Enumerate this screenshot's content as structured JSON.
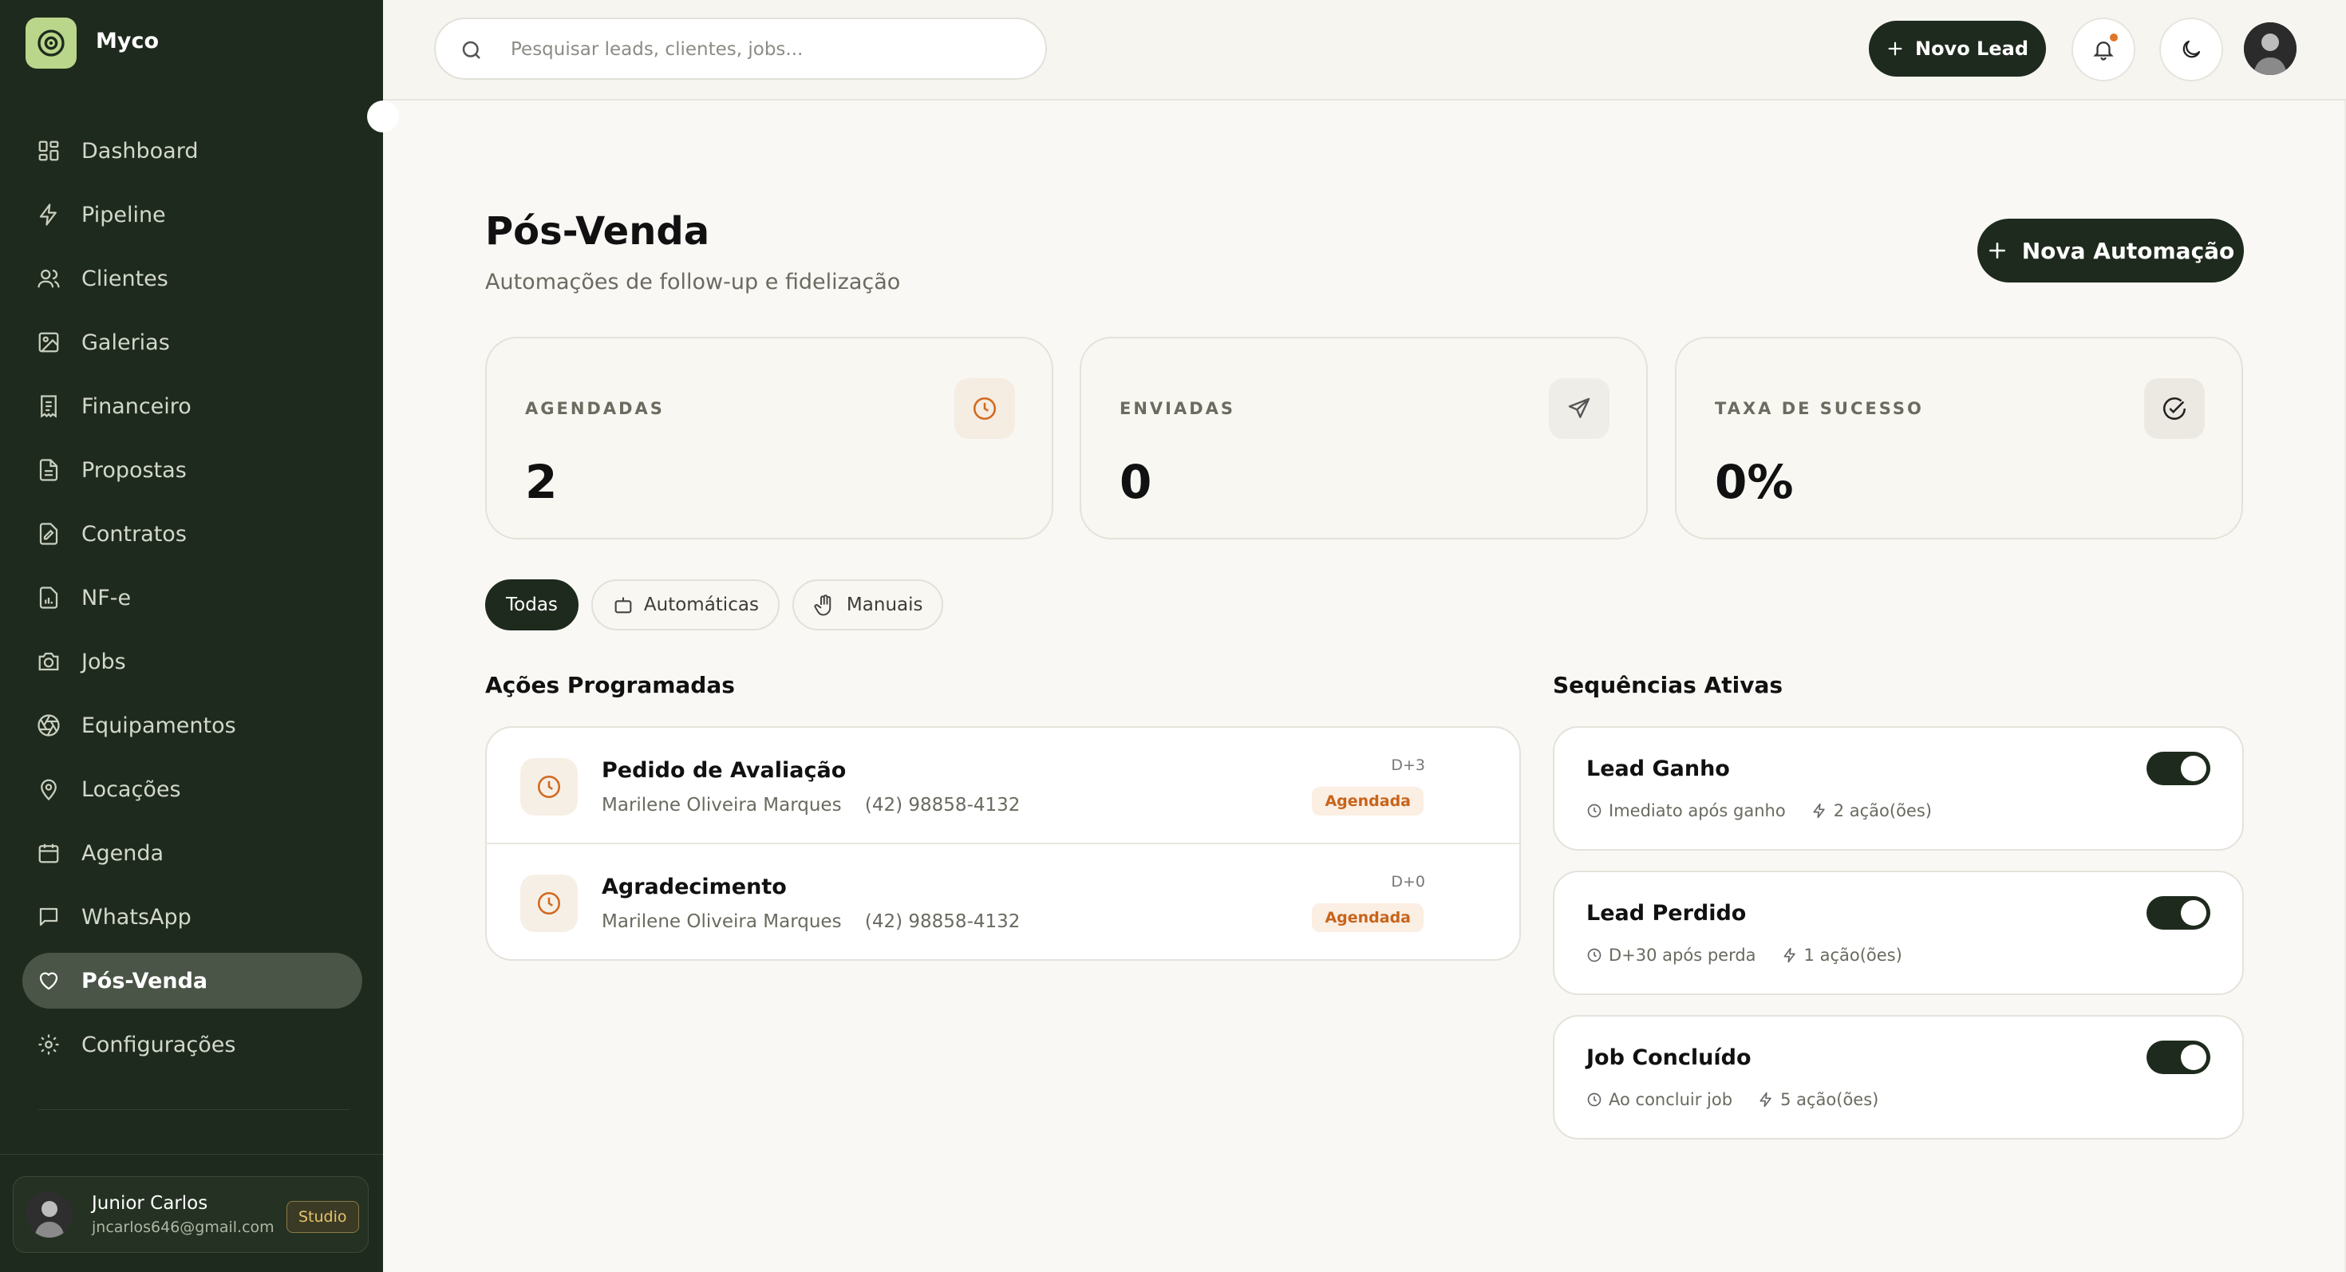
{
  "app": {
    "name": "Myco"
  },
  "sidebar": {
    "items": [
      {
        "label": "Dashboard",
        "icon": "dashboard-icon"
      },
      {
        "label": "Pipeline",
        "icon": "bolt-icon"
      },
      {
        "label": "Clientes",
        "icon": "users-icon"
      },
      {
        "label": "Galerias",
        "icon": "image-icon"
      },
      {
        "label": "Financeiro",
        "icon": "receipt-icon"
      },
      {
        "label": "Propostas",
        "icon": "document-icon"
      },
      {
        "label": "Contratos",
        "icon": "contract-icon"
      },
      {
        "label": "NF-e",
        "icon": "invoice-icon"
      },
      {
        "label": "Jobs",
        "icon": "camera-icon"
      },
      {
        "label": "Equipamentos",
        "icon": "aperture-icon"
      },
      {
        "label": "Locações",
        "icon": "map-pin-icon"
      },
      {
        "label": "Agenda",
        "icon": "calendar-icon"
      },
      {
        "label": "WhatsApp",
        "icon": "chat-icon"
      },
      {
        "label": "Pós-Venda",
        "icon": "heart-icon",
        "active": true
      },
      {
        "label": "Configurações",
        "icon": "gear-icon"
      }
    ],
    "user": {
      "name": "Junior Carlos",
      "email": "jncarlos646@gmail.com",
      "plan": "Studio"
    }
  },
  "topbar": {
    "search_placeholder": "Pesquisar leads, clientes, jobs...",
    "new_lead_label": "Novo Lead"
  },
  "page": {
    "title": "Pós-Venda",
    "subtitle": "Automações de follow-up e fidelização",
    "new_automation_label": "Nova Automação"
  },
  "stats": [
    {
      "label": "AGENDADAS",
      "value": "2",
      "icon": "clock-icon",
      "icon_color": "#d2691e",
      "icon_bg": "#f5ece2"
    },
    {
      "label": "ENVIADAS",
      "value": "0",
      "icon": "send-icon",
      "icon_color": "#555555",
      "icon_bg": "#eeede8"
    },
    {
      "label": "TAXA DE SUCESSO",
      "value": "0%",
      "icon": "check-circle-icon",
      "icon_color": "#222222",
      "icon_bg": "#ebe9e2"
    }
  ],
  "filters": [
    {
      "label": "Todas",
      "active": true
    },
    {
      "label": "Automáticas",
      "icon": "bot-icon"
    },
    {
      "label": "Manuais",
      "icon": "hand-icon"
    }
  ],
  "scheduled": {
    "title": "Ações Programadas",
    "items": [
      {
        "title": "Pedido de Avaliação",
        "client": "Marilene Oliveira Marques",
        "phone": "(42) 98858-4132",
        "offset": "D+3",
        "status": "Agendada"
      },
      {
        "title": "Agradecimento",
        "client": "Marilene Oliveira Marques",
        "phone": "(42) 98858-4132",
        "offset": "D+0",
        "status": "Agendada"
      }
    ]
  },
  "sequences": {
    "title": "Sequências Ativas",
    "items": [
      {
        "title": "Lead Ganho",
        "trigger": "Imediato após ganho",
        "actions": "2 ação(ões)",
        "enabled": true
      },
      {
        "title": "Lead Perdido",
        "trigger": "D+30 após perda",
        "actions": "1 ação(ões)",
        "enabled": true
      },
      {
        "title": "Job Concluído",
        "trigger": "Ao concluir job",
        "actions": "5 ação(ões)",
        "enabled": true
      }
    ]
  },
  "colors": {
    "sidebar_bg": "#1e2a1d",
    "accent_green": "#b9d68a",
    "status_orange": "#c8641b"
  }
}
